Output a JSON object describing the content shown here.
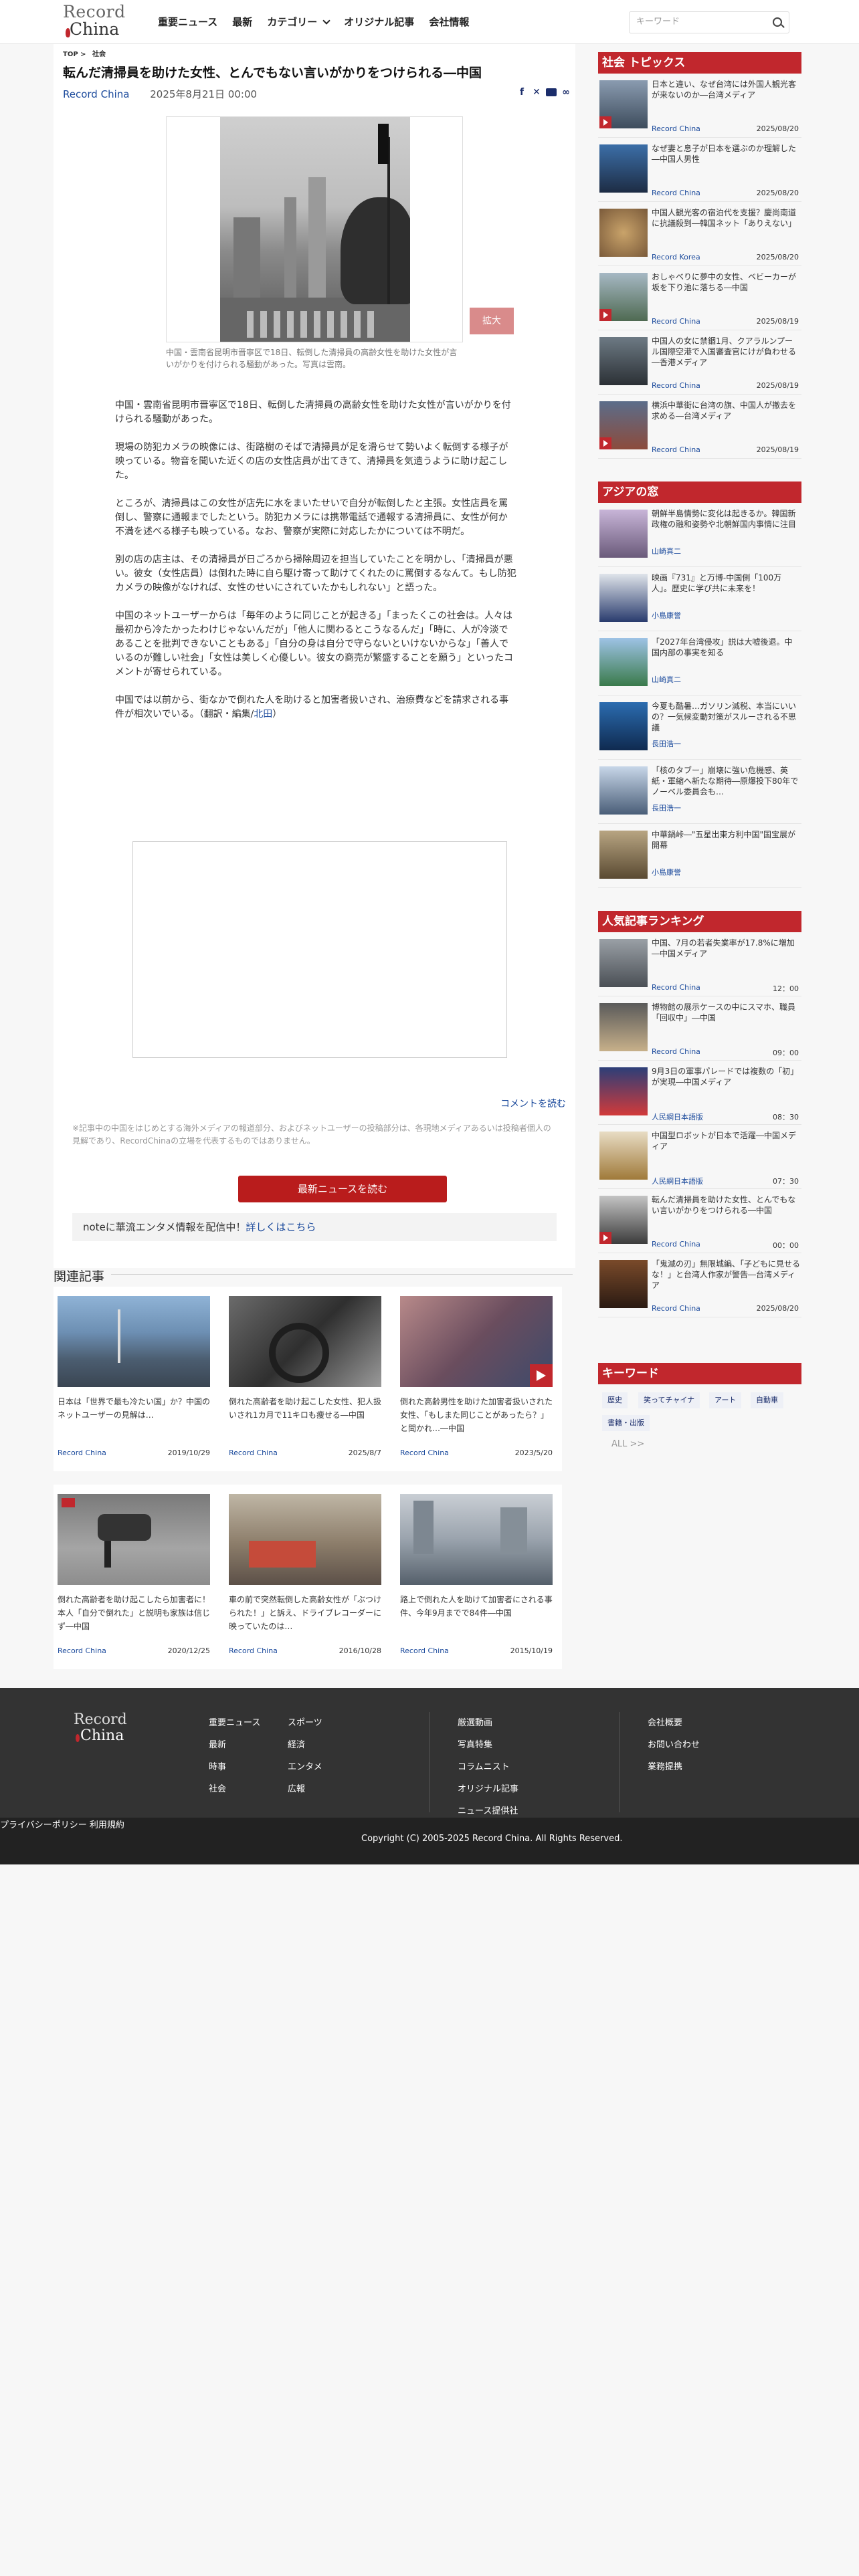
{
  "header": {
    "logo_line1": "Record",
    "logo_line2": "China",
    "nav": [
      "重要ニュース",
      "最新",
      "カテゴリー",
      "オリジナル記事",
      "会社情報"
    ],
    "search_placeholder": "キーワード"
  },
  "breadcrumb": [
    "TOP",
    ">",
    "社会"
  ],
  "article": {
    "title": "転んだ清掃員を助けた女性、とんでもない言いがかりをつけられる―中国",
    "source": "Record China",
    "date": "2025年8月21日 00:00",
    "zoom_label": "拡大",
    "caption": "中国・雲南省昆明市晋寧区で18日、転倒した清掃員の高齢女性を助けた女性が言いがかりを付けられる騒動があった。写真は雲南。",
    "paragraphs": [
      "中国・雲南省昆明市晋寧区で18日、転倒した清掃員の高齢女性を助けた女性が言いがかりを付けられる騒動があった。",
      "現場の防犯カメラの映像には、街路樹のそばで清掃員が足を滑らせて勢いよく転倒する様子が映っている。物音を聞いた近くの店の女性店員が出てきて、清掃員を気遣うように助け起こした。",
      "ところが、清掃員はこの女性が店先に水をまいたせいで自分が転倒したと主張。女性店員を罵倒し、警察に通報までしたという。防犯カメラには携帯電話で通報する清掃員に、女性が何か不満を述べる様子も映っている。なお、警察が実際に対応したかについては不明だ。",
      "別の店の店主は、その清掃員が日ごろから掃除周辺を担当していたことを明かし、「清掃員が悪い。彼女（女性店員）は倒れた時に自ら駆け寄って助けてくれたのに罵倒するなんて。もし防犯カメラの映像がなければ、女性のせいにされていたかもしれない」と語った。",
      "中国のネットユーザーからは「毎年のように同じことが起きる」「まったくこの社会は。人々は最初から冷たかったわけじゃないんだが」「他人に関わるとこうなるんだ」「時に、人が冷淡であることを批判できないこともある」「自分の身は自分で守らないといけないからな」「善人でいるのが難しい社会」「女性は美しく心優しい。彼女の商売が繁盛することを願う」といったコメントが寄せられている。",
      "中国では以前から、街なかで倒れた人を助けると加害者扱いされ、治療費などを請求される事件が相次いでいる。（翻訳・編集/"
    ],
    "editor": "北田",
    "paragraph_end": "）",
    "comment_link": "コメントを読む",
    "notice": "※記事中の中国をはじめとする海外メディアの報道部分、およびネットユーザーの投稿部分は、各現地メディアあるいは投稿者個人の見解であり、RecordChinaの立場を代表するものではありません。",
    "latest_button": "最新ニュースを読む",
    "note_text": "noteに華流エンタメ情報を配信中！",
    "note_link": "詳しくはこちら"
  },
  "related": {
    "heading": "関連記事",
    "items": [
      {
        "text": "日本は「世界で最も冷たい国」か？中国のネットユーザーの見解は…",
        "source": "Record China",
        "date": "2019/10/29"
      },
      {
        "text": "倒れた高齢者を助け起こした女性、犯人扱いされ1カ月で11キロも痩せる―中国",
        "source": "Record China",
        "date": "2025/8/7"
      },
      {
        "text": "倒れた高齢男性を助けた加害者扱いされた女性、「もしまた同じことがあったら？」と聞かれ…―中国",
        "source": "Record China",
        "date": "2023/5/20"
      },
      {
        "text": "倒れた高齢者を助け起こしたら加害者に！ 本人「自分で倒れた」と説明も家族は信じず―中国",
        "source": "Record China",
        "date": "2020/12/25"
      },
      {
        "text": "車の前で突然転倒した高齢女性が「ぶつけられた！」と訴え、ドライブレコーダーに映っていたのは…",
        "source": "Record China",
        "date": "2016/10/28"
      },
      {
        "text": "路上で倒れた人を助けて加害者にされる事件、今年9月までで84件―中国",
        "source": "Record China",
        "date": "2015/10/19"
      }
    ]
  },
  "sidebar": {
    "social_heading": "社会 トピックス",
    "social_items": [
      {
        "title": "日本と違い、なぜ台湾には外国人観光客が来ないのか―台湾メディア",
        "source": "Record China",
        "date": "2025/08/20"
      },
      {
        "title": "なぜ妻と息子が日本を選ぶのか理解した―中国人男性",
        "source": "Record China",
        "date": "2025/08/20"
      },
      {
        "title": "中国人観光客の宿泊代を支援？慶尚南道に抗議殺到―韓国ネット「ありえない」",
        "source": "Record Korea",
        "date": "2025/08/20"
      },
      {
        "title": "おしゃべりに夢中の女性、ベビーカーが坂を下り池に落ちる―中国",
        "source": "Record China",
        "date": "2025/08/19"
      },
      {
        "title": "中国人の女に禁錮1月、クアラルンプール国際空港で入国審査官にけが負わせる―香港メディア",
        "source": "Record China",
        "date": "2025/08/19"
      },
      {
        "title": "横浜中華街に台湾の旗、中国人が撤去を求める―台湾メディア",
        "source": "Record China",
        "date": "2025/08/19"
      }
    ],
    "asia_heading": "アジアの窓",
    "asia_items": [
      {
        "title": "朝鮮半島情勢に変化は起きるか。韓国新政権の融和姿勢や北朝鮮国内事情に注目",
        "author": "山崎真二"
      },
      {
        "title": "映画『731』と万博-中国側「100万人」。歴史に学び共に未来を！",
        "author": "小島康誉"
      },
      {
        "title": "「2027年台湾侵攻」説は大嘘後退。中国内部の事実を知る",
        "author": "山崎真二"
      },
      {
        "title": "今夏も酷暑…ガソリン減税、本当にいいの？一気候変動対策がスルーされる不思議",
        "author": "長田浩一"
      },
      {
        "title": "「核のタブー」崩壊に強い危機感、英紙・軍縮へ新たな期待―原爆投下80年でノーベル委員会も…",
        "author": "長田浩一"
      },
      {
        "title": "中華鍋峠―\"五星出東方利中国\"国宝展が開幕",
        "author": "小島康誉"
      }
    ],
    "ranking_heading": "人気記事ランキング",
    "ranking_items": [
      {
        "title": "中国、7月の若者失業率が17.8%に増加―中国メディア",
        "source": "Record China",
        "time": "12：00"
      },
      {
        "title": "博物館の展示ケースの中にスマホ、職員「回収中」―中国",
        "source": "Record China",
        "time": "09：00"
      },
      {
        "title": "9月3日の軍事パレードでは複数の「初」が実現―中国メディア",
        "source": "人民網日本語版",
        "time": "08：30"
      },
      {
        "title": "中国型ロボットが日本で活躍―中国メディア",
        "source": "人民網日本語版",
        "time": "07：30"
      },
      {
        "title": "転んだ清掃員を助けた女性、とんでもない言いがかりをつけられる―中国",
        "source": "Record China",
        "time": "00：00"
      },
      {
        "title": "「鬼滅の刃」無限城編、「子どもに見せるな！」と台湾人作家が警告―台湾メディア",
        "source": "Record China",
        "time": "2025/08/20"
      }
    ],
    "keyword_heading": "キーワード",
    "keywords": [
      "歴史",
      "笑ってチャイナ",
      "アート",
      "自動車",
      "書籍・出版"
    ],
    "all_label": "ALL >>"
  },
  "footer": {
    "logo_line1": "Record",
    "logo_line2": "China",
    "col1": [
      "重要ニュース",
      "最新",
      "時事",
      "社会"
    ],
    "col2": [
      "スポーツ",
      "経済",
      "エンタメ",
      "広報"
    ],
    "col3": [
      "厳選動画",
      "写真特集",
      "コラムニスト",
      "オリジナル記事",
      "ニュース提供社"
    ],
    "col4": [
      "会社概要",
      "お問い合わせ",
      "業務提携"
    ],
    "privacy": "プライバシーポリシー",
    "terms": "利用規約",
    "copyright": "Copyright (C) 2005-2025 Record China. All Rights Reserved."
  }
}
